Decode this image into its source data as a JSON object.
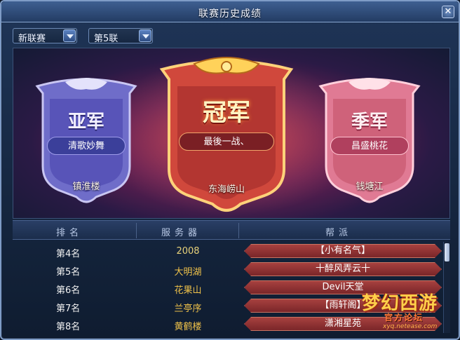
{
  "window": {
    "title": "联赛历史成绩",
    "close_label": "✕"
  },
  "filters": {
    "league": "新联赛",
    "season": "第5联"
  },
  "podium": {
    "second": {
      "title": "亚军",
      "team": "清歌妙舞",
      "server": "镇淮楼"
    },
    "first": {
      "title": "冠军",
      "team": "最後一战、",
      "server": "东海崂山"
    },
    "third": {
      "title": "季军",
      "team": "昌盛桃花",
      "server": "钱塘江"
    }
  },
  "table": {
    "headers": {
      "rank": "排名",
      "server": "服务器",
      "guild": "帮派"
    },
    "rows": [
      {
        "rank": "第4名",
        "server": "2008",
        "guild": "【小有名气】"
      },
      {
        "rank": "第5名",
        "server": "大明湖",
        "guild": "十醉风弄云十"
      },
      {
        "rank": "第6名",
        "server": "花果山",
        "guild": "Devil天堂"
      },
      {
        "rank": "第7名",
        "server": "兰亭序",
        "guild": "【雨轩阁】"
      },
      {
        "rank": "第8名",
        "server": "黄鹤楼",
        "guild": "潇湘星苑"
      }
    ]
  },
  "watermark": {
    "logo": "梦幻西游",
    "sub": "官方论坛",
    "url": "xyq.netease.com"
  },
  "colors": {
    "server_4th": "#e8d27a",
    "server_other": "#f0c24a",
    "second_team_bg": "#3b3f9a",
    "first_team_bg": "#7a1f24",
    "third_team_bg": "#b0405e"
  }
}
